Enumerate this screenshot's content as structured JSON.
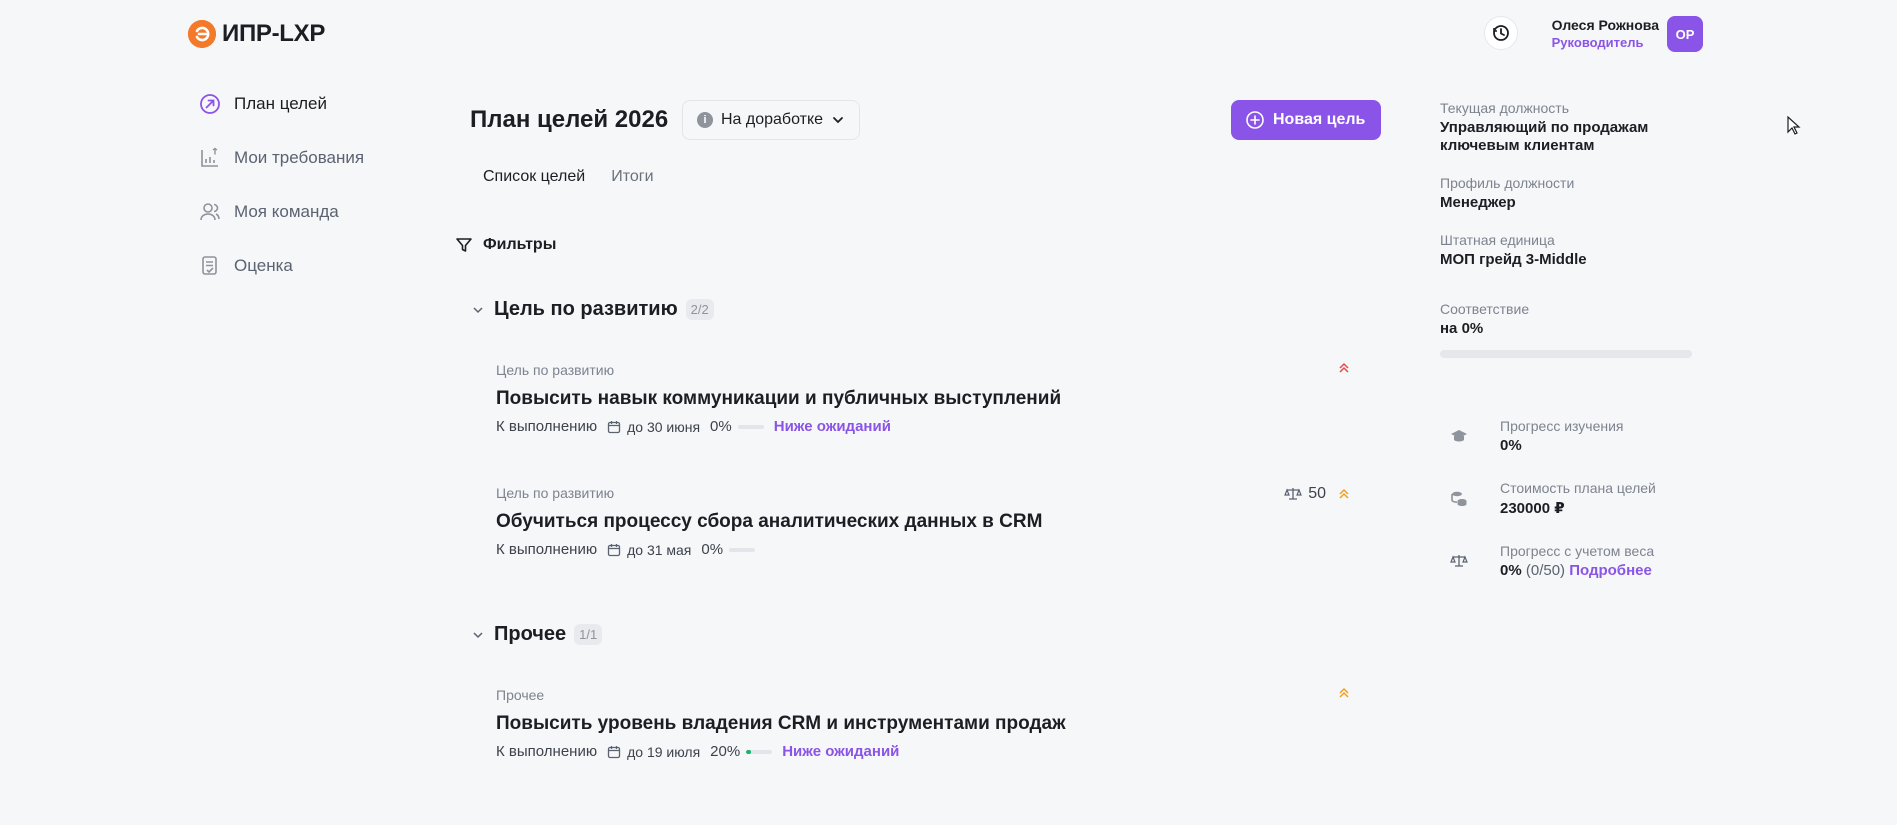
{
  "header": {
    "logo_text": "ИПР-LXP",
    "user_name": "Олеся Рожнова",
    "user_role": "Руководитель",
    "avatar_initials": "ОР"
  },
  "sidebar": {
    "items": [
      {
        "label": "План целей",
        "icon": "goal-arrow-icon",
        "active": true
      },
      {
        "label": "Мои требования",
        "icon": "chart-upload-icon",
        "active": false
      },
      {
        "label": "Моя команда",
        "icon": "team-icon",
        "active": false
      },
      {
        "label": "Оценка",
        "icon": "document-check-icon",
        "active": false
      }
    ]
  },
  "main": {
    "title": "План целей 2026",
    "status": "На доработке",
    "new_goal_label": "Новая цель",
    "tabs": [
      {
        "label": "Список целей",
        "active": true
      },
      {
        "label": "Итоги",
        "active": false
      }
    ],
    "filters_label": "Фильтры",
    "groups": [
      {
        "title": "Цель по развитию",
        "count": "2/2",
        "goals": [
          {
            "type": "Цель по развитию",
            "title": "Повысить навык коммуникации и публичных выступлений",
            "status": "К выполнению",
            "date": "до 30 июня",
            "percent": "0%",
            "progress": 0,
            "rating": "Ниже ожиданий",
            "weight": "",
            "priority_color": "#e5484d"
          },
          {
            "type": "Цель по развитию",
            "title": "Обучиться процессу сбора аналитических данных в CRM",
            "status": "К выполнению",
            "date": "до 31 мая",
            "percent": "0%",
            "progress": 0,
            "rating": "",
            "weight": "50",
            "priority_color": "#f0a01c"
          }
        ]
      },
      {
        "title": "Прочее",
        "count": "1/1",
        "goals": [
          {
            "type": "Прочее",
            "title": "Повысить уровень владения CRM и инструментами продаж",
            "status": "К выполнению",
            "date": "до 19 июля",
            "percent": "20%",
            "progress": 0.2,
            "rating": "Ниже ожиданий",
            "weight": "",
            "priority_color": "#f0a01c"
          }
        ]
      }
    ]
  },
  "info": {
    "position_label": "Текущая должность",
    "position_value": "Управляющий по продажам ключевым клиентам",
    "profile_label": "Профиль должности",
    "profile_value": "Менеджер",
    "unit_label": "Штатная единица",
    "unit_value": "МОП грейд 3-Middle",
    "conformity_label": "Соответствие",
    "conformity_value": "на 0%",
    "conformity_progress": 0,
    "stats": [
      {
        "label": "Прогресс изучения",
        "value": "0%",
        "icon": "graduation-cap-icon"
      },
      {
        "label": "Стоимость плана целей",
        "value": "230000 ₽",
        "icon": "coins-icon"
      },
      {
        "label": "Прогресс с учетом веса",
        "value": "0%",
        "extra": "(0/50)",
        "link": "Подробнее",
        "icon": "scales-icon"
      }
    ]
  },
  "colors": {
    "accent": "#8b54e8",
    "brand_orange": "#f37a2b",
    "progress_green": "#19b46c"
  }
}
